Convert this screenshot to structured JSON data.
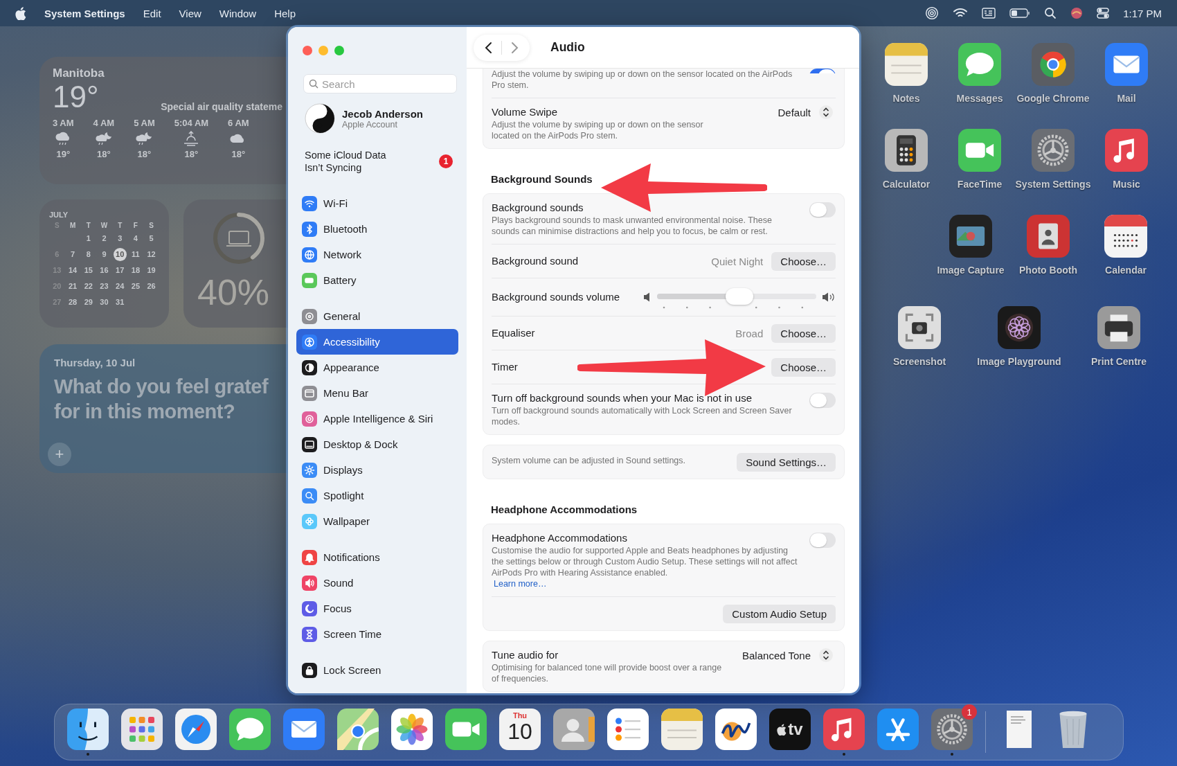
{
  "menu_bar": {
    "app_name": "System Settings",
    "menus": [
      "Edit",
      "View",
      "Window",
      "Help"
    ],
    "clock": "1:17 PM"
  },
  "widgets": {
    "weather": {
      "location": "Manitoba",
      "temperature": "19°",
      "alert": "Special air quality stateme",
      "hours": [
        {
          "time": "3 AM",
          "kind": "rain",
          "temp": "19°"
        },
        {
          "time": "4 AM",
          "kind": "moon-rain",
          "temp": "18°"
        },
        {
          "time": "5 AM",
          "kind": "moon-rain",
          "temp": "18°"
        },
        {
          "time": "5:04 AM",
          "kind": "sunrise",
          "temp": "18°"
        },
        {
          "time": "6 AM",
          "kind": "cloud",
          "temp": "18°"
        }
      ]
    },
    "calendar": {
      "month": "JULY",
      "weekdays": [
        "S",
        "M",
        "T",
        "W",
        "T",
        "F",
        "S"
      ],
      "weeks": [
        [
          {
            "day": "1",
            "selected": false
          },
          {
            "day": "2",
            "selected": false
          },
          {
            "day": "3",
            "selected": false
          },
          {
            "day": "4",
            "selected": false
          },
          {
            "day": "5",
            "selected": false
          }
        ],
        [
          {
            "day": "6",
            "selected": false
          },
          {
            "day": "7",
            "selected": false
          },
          {
            "day": "8",
            "selected": false
          },
          {
            "day": "9",
            "selected": false
          },
          {
            "day": "10",
            "selected": true
          },
          {
            "day": "11",
            "selected": false
          },
          {
            "day": "12",
            "selected": false
          }
        ],
        [
          {
            "day": "13",
            "selected": false
          },
          {
            "day": "14",
            "selected": false
          },
          {
            "day": "15",
            "selected": false
          },
          {
            "day": "16",
            "selected": false
          },
          {
            "day": "17",
            "selected": false
          },
          {
            "day": "18",
            "selected": false
          },
          {
            "day": "19",
            "selected": false
          }
        ],
        [
          {
            "day": "20",
            "selected": false
          },
          {
            "day": "21",
            "selected": false
          },
          {
            "day": "22",
            "selected": false
          },
          {
            "day": "23",
            "selected": false
          },
          {
            "day": "24",
            "selected": false
          },
          {
            "day": "25",
            "selected": false
          },
          {
            "day": "26",
            "selected": false
          }
        ],
        [
          {
            "day": "27",
            "selected": false
          },
          {
            "day": "28",
            "selected": false
          },
          {
            "day": "29",
            "selected": false
          },
          {
            "day": "30",
            "selected": false
          },
          {
            "day": "31",
            "selected": false
          }
        ]
      ]
    },
    "battery": {
      "percent": "40%"
    },
    "journal": {
      "date": "Thursday, 10 Jul",
      "prompt": "What do you feel gratef\nfor in this moment?",
      "add_button": "+"
    }
  },
  "window": {
    "sidebar": {
      "search_placeholder": "Search",
      "account": {
        "name": "Jecob Anderson",
        "subtitle": "Apple Account"
      },
      "notice": {
        "text": "Some iCloud Data Isn’t Syncing",
        "badge": "1"
      },
      "groups": [
        [
          {
            "label": "Wi-Fi",
            "color": "#2f7cf6",
            "selected": false
          },
          {
            "label": "Bluetooth",
            "color": "#2f7cf6",
            "selected": false
          },
          {
            "label": "Network",
            "color": "#2f7cf6",
            "selected": false
          },
          {
            "label": "Battery",
            "color": "#5ac85a",
            "selected": false
          }
        ],
        [
          {
            "label": "General",
            "color": "#8e8e93",
            "selected": false
          },
          {
            "label": "Accessibility",
            "color": "#2f7cf6",
            "selected": true
          },
          {
            "label": "Appearance",
            "color": "#1c1c1e",
            "selected": false
          },
          {
            "label": "Menu Bar",
            "color": "#8e8e93",
            "selected": false
          },
          {
            "label": "Apple Intelligence & Siri",
            "color": "#e0609a",
            "selected": false
          },
          {
            "label": "Desktop & Dock",
            "color": "#1c1c1e",
            "selected": false
          },
          {
            "label": "Displays",
            "color": "#3b8cf6",
            "selected": false
          },
          {
            "label": "Spotlight",
            "color": "#3b8cf6",
            "selected": false
          },
          {
            "label": "Wallpaper",
            "color": "#5ac8fa",
            "selected": false
          }
        ],
        [
          {
            "label": "Notifications",
            "color": "#ef4444",
            "selected": false
          },
          {
            "label": "Sound",
            "color": "#ef4466",
            "selected": false
          },
          {
            "label": "Focus",
            "color": "#5e5ce6",
            "selected": false
          },
          {
            "label": "Screen Time",
            "color": "#5e5ce6",
            "selected": false
          }
        ],
        [
          {
            "label": "Lock Screen",
            "color": "#1c1c1e",
            "selected": false
          }
        ]
      ]
    },
    "header": {
      "title": "Audio"
    },
    "sections": [
      {
        "kind": "card",
        "rows": [
          {
            "kind": "toggle",
            "description": "Adjust the volume by swiping up or down on the sensor located on the AirPods Pro stem.",
            "on": true
          },
          {
            "kind": "popup",
            "label": "Volume Swipe",
            "description": "Adjust the volume by swiping up or down on the sensor located on the AirPods Pro stem.",
            "value": "Default"
          }
        ]
      },
      {
        "kind": "heading",
        "title": "Background Sounds"
      },
      {
        "kind": "card",
        "rows": [
          {
            "kind": "toggle",
            "label": "Background sounds",
            "description": "Plays background sounds to mask unwanted environmental noise. These sounds can minimise distractions and help you to focus, be calm or rest.",
            "on": false
          },
          {
            "kind": "choose",
            "label": "Background sound",
            "value": "Quiet Night",
            "button": "Choose…"
          },
          {
            "kind": "slider",
            "label": "Background sounds volume",
            "level": 0.52
          },
          {
            "kind": "choose",
            "label": "Equaliser",
            "value": "Broad",
            "button": "Choose…"
          },
          {
            "kind": "choose",
            "label": "Timer",
            "button": "Choose…"
          },
          {
            "kind": "toggle",
            "label": "Turn off background sounds when your Mac is not in use",
            "description": "Turn off background sounds automatically with Lock Screen and Screen Saver modes.",
            "on": false
          }
        ]
      },
      {
        "kind": "card",
        "rows": [
          {
            "kind": "note",
            "description": "System volume can be adjusted in Sound settings.",
            "button": "Sound Settings…"
          }
        ]
      },
      {
        "kind": "heading",
        "title": "Headphone Accommodations"
      },
      {
        "kind": "card",
        "rows": [
          {
            "kind": "toggle",
            "label": "Headphone Accommodations",
            "description": "Customise the audio for supported Apple and Beats headphones by adjusting the settings below or through Custom Audio Setup. These settings will not affect AirPods Pro with Hearing Assistance enabled.",
            "link": "Learn more…",
            "on": false
          },
          {
            "kind": "button",
            "button": "Custom Audio Setup"
          }
        ]
      },
      {
        "kind": "card",
        "rows": [
          {
            "kind": "popup",
            "label": "Tune audio for",
            "description": "Optimising for balanced tone will provide boost over a range of frequencies.",
            "value": "Balanced Tone"
          }
        ]
      }
    ]
  },
  "desktop_icons": [
    [
      {
        "label": "Notes",
        "kind": "notes"
      },
      {
        "label": "Messages",
        "kind": "messages"
      },
      {
        "label": "Google Chrome",
        "kind": "chrome"
      },
      {
        "label": "Mail",
        "kind": "mail"
      }
    ],
    [
      {
        "label": "Calculator",
        "kind": "calculator"
      },
      {
        "label": "FaceTime",
        "kind": "facetime"
      },
      {
        "label": "System Settings",
        "kind": "settings"
      },
      {
        "label": "Music",
        "kind": "music"
      }
    ],
    [
      {
        "label": "Image Capture",
        "kind": "imagecapture"
      },
      {
        "label": "Photo Booth",
        "kind": "photobooth"
      },
      {
        "label": "Calendar",
        "kind": "calendar"
      }
    ],
    [
      {
        "label": "Screenshot",
        "kind": "screenshot"
      },
      {
        "label": "Image Playground",
        "kind": "playground"
      },
      {
        "label": "Print Centre",
        "kind": "print"
      }
    ]
  ],
  "dock": [
    {
      "kind": "finder",
      "running": true
    },
    {
      "kind": "launchpad",
      "running": false
    },
    {
      "kind": "safari",
      "running": false
    },
    {
      "kind": "messages",
      "running": false
    },
    {
      "kind": "mail",
      "running": false
    },
    {
      "kind": "maps",
      "running": false
    },
    {
      "kind": "photos",
      "running": false
    },
    {
      "kind": "facetime",
      "running": false
    },
    {
      "kind": "calendar-date",
      "weekday": "Thu",
      "day": "10",
      "running": false
    },
    {
      "kind": "contacts",
      "running": false
    },
    {
      "kind": "reminders",
      "running": false
    },
    {
      "kind": "notes",
      "running": false
    },
    {
      "kind": "freeform",
      "running": false
    },
    {
      "kind": "tv",
      "label": "tv",
      "running": false
    },
    {
      "kind": "music",
      "running": true
    },
    {
      "kind": "appstore",
      "running": false
    },
    {
      "kind": "settings",
      "badge": "1",
      "running": true
    },
    {
      "kind": "separator"
    },
    {
      "kind": "document",
      "running": false
    },
    {
      "kind": "trash",
      "running": false
    }
  ]
}
